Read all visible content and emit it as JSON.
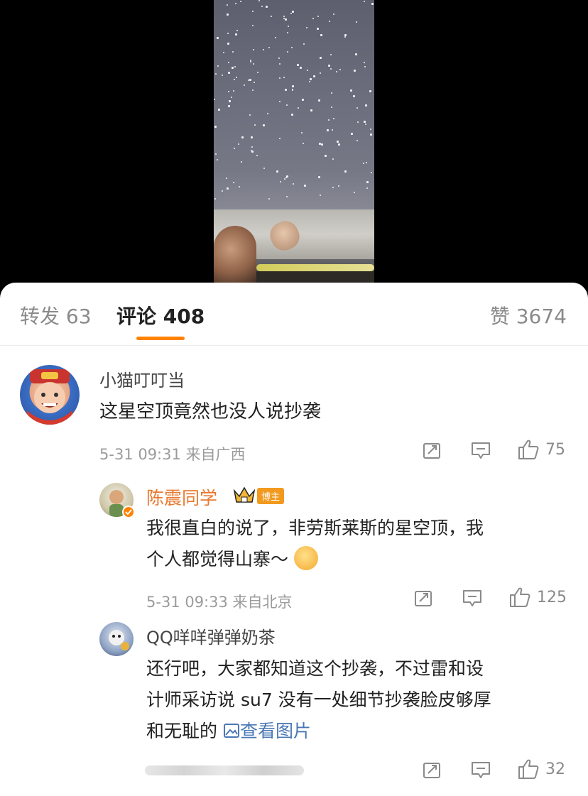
{
  "tabs": {
    "reposts": "转发 63",
    "comments": "评论 408",
    "likes": "赞 3674"
  },
  "comments": [
    {
      "user": "小猫叮叮当",
      "text": "这星空顶竟然也没人说抄袭",
      "meta": "5-31 09:31  来自广西",
      "likes": "75",
      "replies": [
        {
          "user": "陈震同学",
          "badge": "博主",
          "text_line1": "我很直白的说了，非劳斯莱斯的星空顶，我",
          "text_line2": "个人都觉得山寨～",
          "meta": "5-31 09:33  来自北京",
          "likes": "125"
        },
        {
          "user": "QQ咩咩弹弹奶茶",
          "text_line1": "还行吧，大家都知道这个抄袭，不过雷和设",
          "text_line2": "计师采访说 su7 没有一处细节抄袭脸皮够厚",
          "text_line3": "和无耻的",
          "link": "查看图片",
          "likes": "32"
        }
      ]
    }
  ],
  "colors": {
    "accent": "#ff8200",
    "blogger_name": "#e8782e",
    "link": "#4a78b5"
  },
  "icons": [
    "repost-icon",
    "comment-icon",
    "like-icon",
    "image-icon",
    "crown-icon",
    "blushing-emoji-icon"
  ]
}
